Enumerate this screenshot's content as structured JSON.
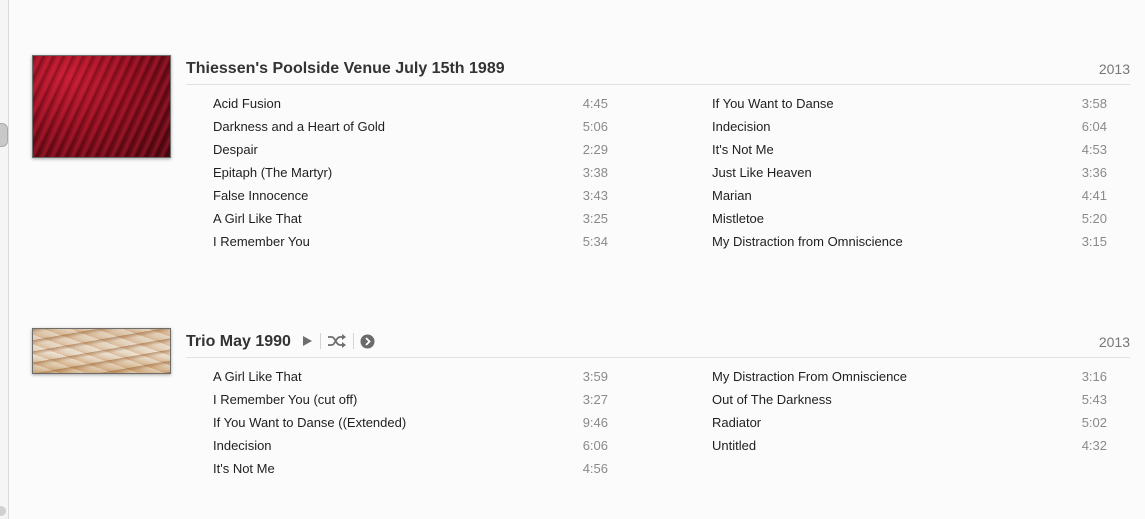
{
  "albums": [
    {
      "title": "Thiessen's Poolside Venue July 15th 1989",
      "year": "2013",
      "artwork": "red-hair-artwork",
      "left_tracks": [
        {
          "name": "Acid Fusion",
          "time": "4:45"
        },
        {
          "name": "Darkness and a Heart of Gold",
          "time": "5:06"
        },
        {
          "name": "Despair",
          "time": "2:29"
        },
        {
          "name": "Epitaph (The Martyr)",
          "time": "3:38"
        },
        {
          "name": "False Innocence",
          "time": "3:43"
        },
        {
          "name": "A Girl Like That",
          "time": "3:25"
        },
        {
          "name": "I Remember You",
          "time": "5:34"
        }
      ],
      "right_tracks": [
        {
          "name": "If You Want to Danse",
          "time": "3:58"
        },
        {
          "name": "Indecision",
          "time": "6:04"
        },
        {
          "name": "It's Not Me",
          "time": "4:53"
        },
        {
          "name": "Just Like Heaven",
          "time": "3:36"
        },
        {
          "name": "Marian",
          "time": "4:41"
        },
        {
          "name": "Mistletoe",
          "time": "5:20"
        },
        {
          "name": "My Distraction from Omniscience",
          "time": "3:15"
        }
      ]
    },
    {
      "title": "Trio May 1990",
      "year": "2013",
      "artwork": "sand-artwork",
      "controls": [
        "play-icon",
        "shuffle-icon",
        "arrow-circle-icon"
      ],
      "left_tracks": [
        {
          "name": "A Girl Like That",
          "time": "3:59"
        },
        {
          "name": "I Remember You (cut off)",
          "time": "3:27"
        },
        {
          "name": "If You Want to Danse ((Extended)",
          "time": "9:46"
        },
        {
          "name": "Indecision",
          "time": "6:06"
        },
        {
          "name": "It's Not Me",
          "time": "4:56"
        }
      ],
      "right_tracks": [
        {
          "name": "My Distraction From Omniscience",
          "time": "3:16"
        },
        {
          "name": "Out of The Darkness",
          "time": "5:43"
        },
        {
          "name": "Radiator",
          "time": "5:02"
        },
        {
          "name": "Untitled",
          "time": "4:32"
        }
      ]
    }
  ]
}
